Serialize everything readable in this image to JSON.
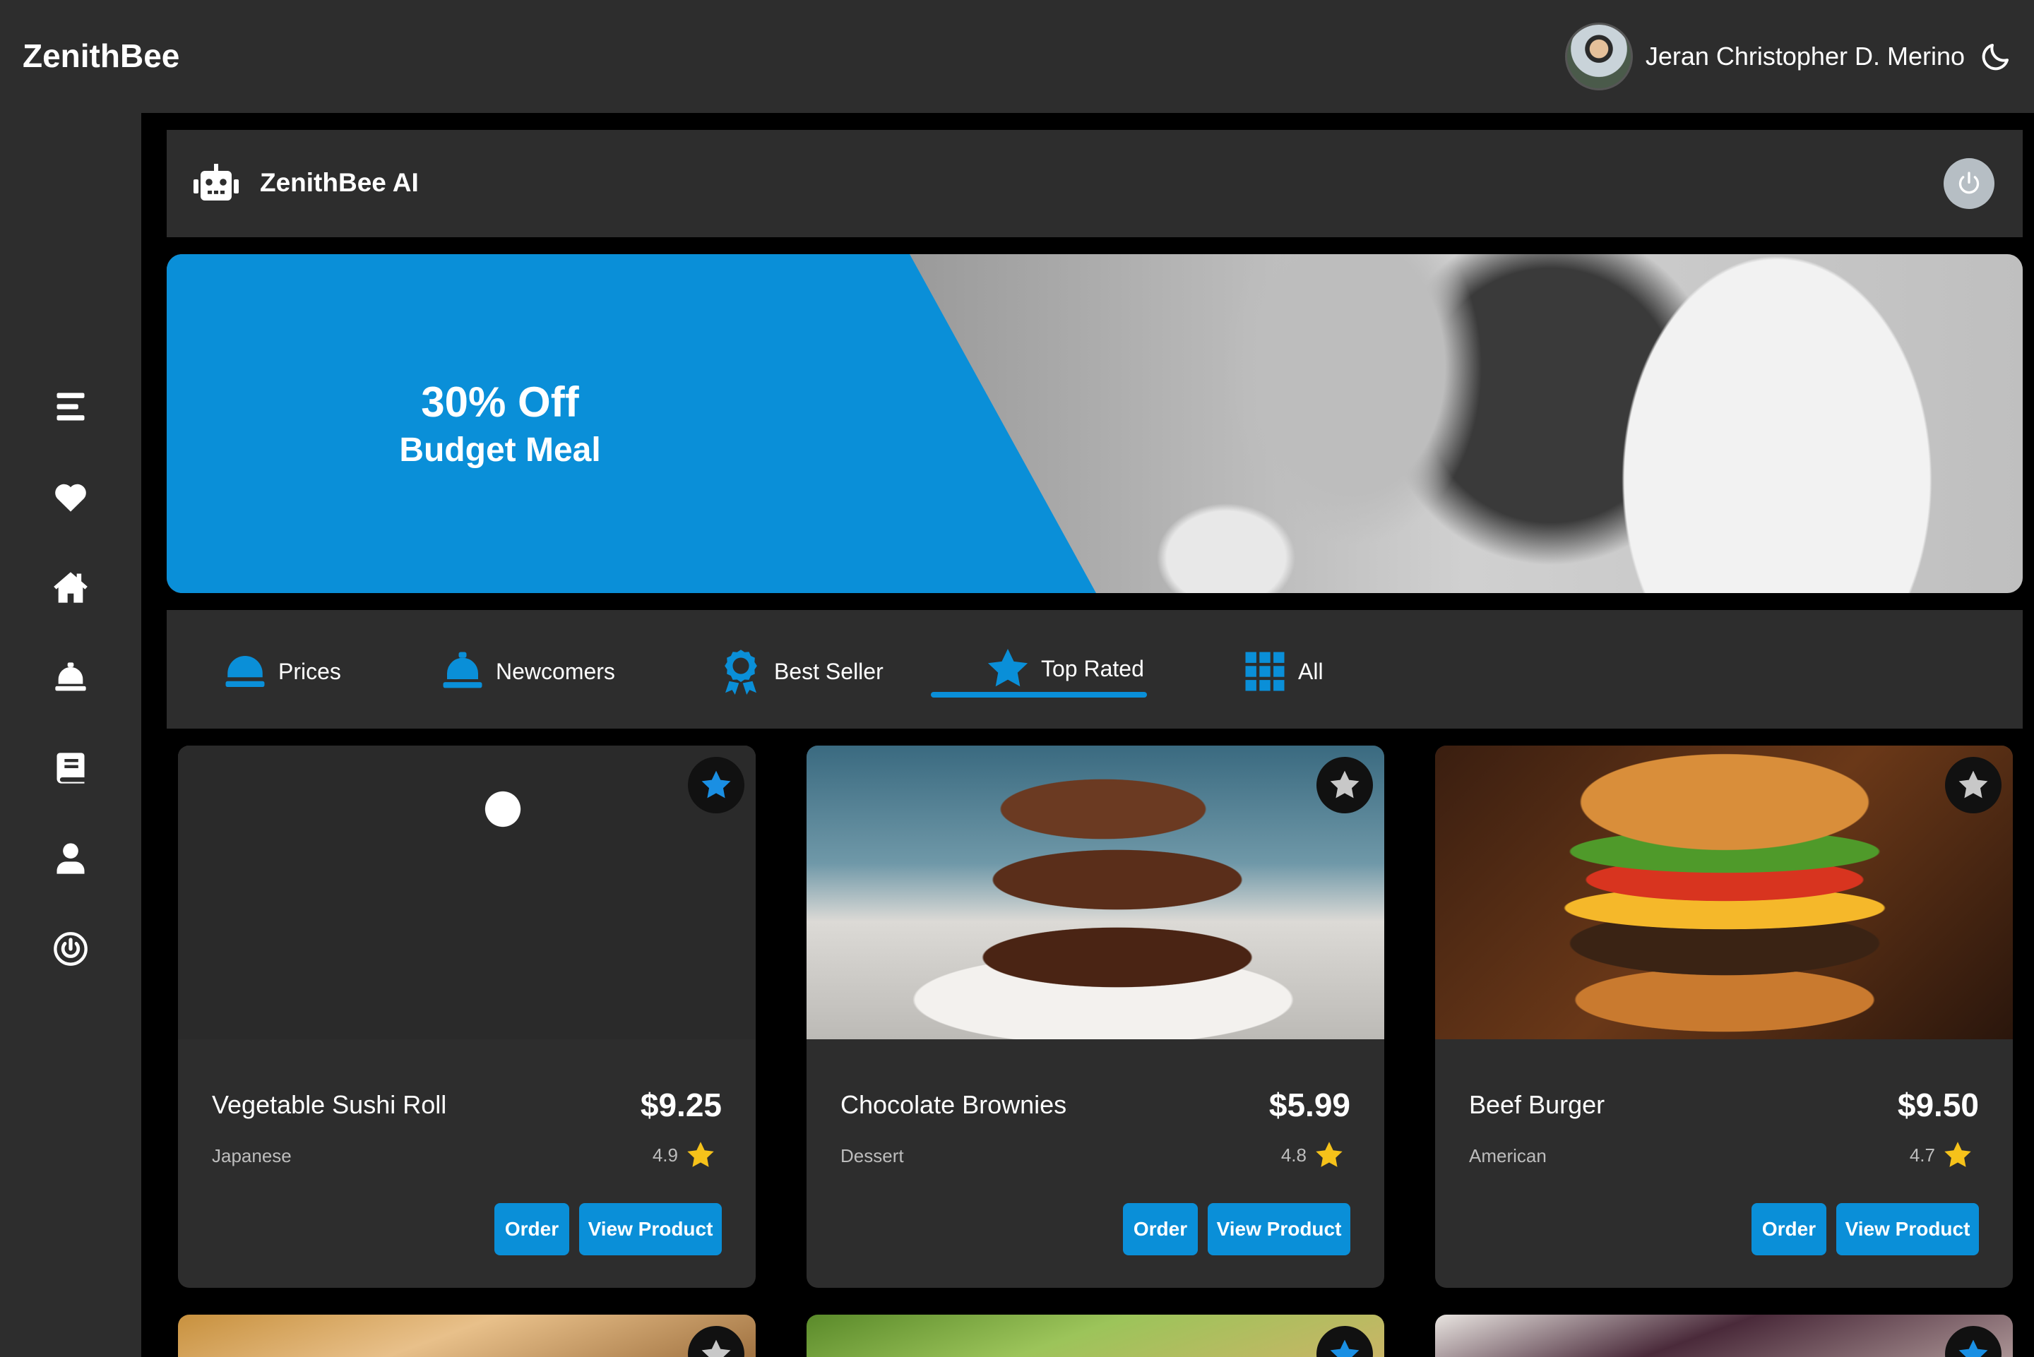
{
  "app": {
    "brand": "ZenithBee"
  },
  "user": {
    "name": "Jeran Christopher D. Merino"
  },
  "ai_bar": {
    "title": "ZenithBee AI"
  },
  "banner": {
    "line1": "30% Off",
    "line2": "Budget Meal"
  },
  "tabs": [
    {
      "label": "Prices",
      "icon": "serving-dome-icon"
    },
    {
      "label": "Newcomers",
      "icon": "bell-icon"
    },
    {
      "label": "Best Seller",
      "icon": "award-ribbon-icon"
    },
    {
      "label": "Top Rated",
      "icon": "star-icon",
      "active": true
    },
    {
      "label": "All",
      "icon": "grid-icon"
    }
  ],
  "sidebar": {
    "items": [
      "menu-icon",
      "heart-icon",
      "home-icon",
      "serving-bell-icon",
      "book-icon",
      "user-icon",
      "power-icon"
    ]
  },
  "products": [
    {
      "name": "Vegetable Sushi Roll",
      "price": "$9.25",
      "category": "Japanese",
      "rating": "4.9",
      "favorite": true,
      "order_label": "Order",
      "view_label": "View Product"
    },
    {
      "name": "Chocolate Brownies",
      "price": "$5.99",
      "category": "Dessert",
      "rating": "4.8",
      "favorite": false,
      "order_label": "Order",
      "view_label": "View Product"
    },
    {
      "name": "Beef Burger",
      "price": "$9.50",
      "category": "American",
      "rating": "4.7",
      "favorite": false,
      "order_label": "Order",
      "view_label": "View Product"
    }
  ],
  "colors": {
    "accent": "#0a8fd8",
    "panel": "#2d2d2d",
    "star": "#f6c21a"
  }
}
